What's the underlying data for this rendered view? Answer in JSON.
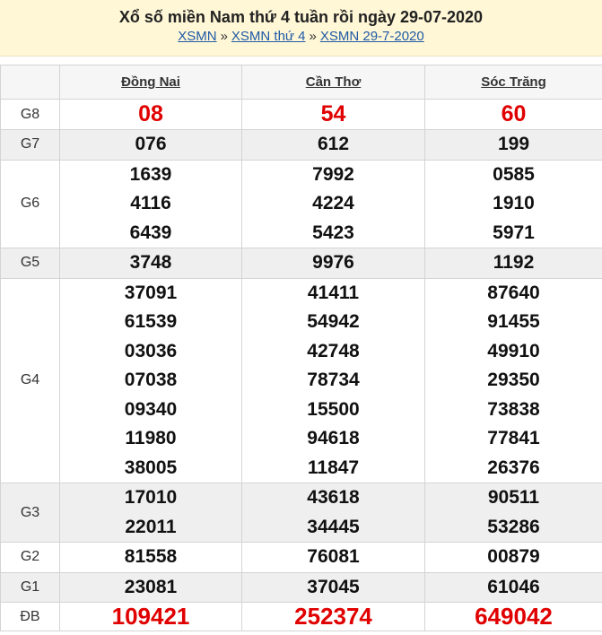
{
  "header": {
    "title": "Xổ số miền Nam thứ 4 tuần rồi ngày 29-07-2020",
    "breadcrumbs": [
      "XSMN",
      "XSMN thứ 4",
      "XSMN 29-7-2020"
    ],
    "separator": "»"
  },
  "table": {
    "columns": [
      "Đồng Nai",
      "Cần Thơ",
      "Sóc Trăng"
    ],
    "colors": {
      "special": "#e00000",
      "normal": "#111111",
      "alt_row": "#efefef"
    },
    "rows": [
      {
        "label": "G8",
        "values": [
          [
            "08"
          ],
          [
            "54"
          ],
          [
            "60"
          ]
        ]
      },
      {
        "label": "G7",
        "values": [
          [
            "076"
          ],
          [
            "612"
          ],
          [
            "199"
          ]
        ]
      },
      {
        "label": "G6",
        "values": [
          [
            "1639",
            "4116",
            "6439"
          ],
          [
            "7992",
            "4224",
            "5423"
          ],
          [
            "0585",
            "1910",
            "5971"
          ]
        ]
      },
      {
        "label": "G5",
        "values": [
          [
            "3748"
          ],
          [
            "9976"
          ],
          [
            "1192"
          ]
        ]
      },
      {
        "label": "G4",
        "values": [
          [
            "37091",
            "61539",
            "03036",
            "07038",
            "09340",
            "11980",
            "38005"
          ],
          [
            "41411",
            "54942",
            "42748",
            "78734",
            "15500",
            "94618",
            "11847"
          ],
          [
            "87640",
            "91455",
            "49910",
            "29350",
            "73838",
            "77841",
            "26376"
          ]
        ]
      },
      {
        "label": "G3",
        "values": [
          [
            "17010",
            "22011"
          ],
          [
            "43618",
            "34445"
          ],
          [
            "90511",
            "53286"
          ]
        ]
      },
      {
        "label": "G2",
        "values": [
          [
            "81558"
          ],
          [
            "76081"
          ],
          [
            "00879"
          ]
        ]
      },
      {
        "label": "G1",
        "values": [
          [
            "23081"
          ],
          [
            "37045"
          ],
          [
            "61046"
          ]
        ]
      },
      {
        "label": "ĐB",
        "values": [
          [
            "109421"
          ],
          [
            "252374"
          ],
          [
            "649042"
          ]
        ]
      }
    ]
  }
}
